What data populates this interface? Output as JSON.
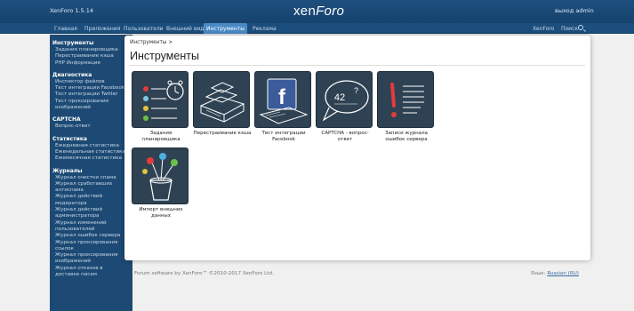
{
  "header": {
    "version": "XenForo 1.5.14",
    "logo": "xenForo",
    "logout": "выход admin"
  },
  "nav": {
    "tabs": [
      "Главная",
      "Приложения",
      "Пользователи",
      "Внешний вид",
      "Инструменты",
      "Реклама"
    ],
    "active_tab": "Инструменты",
    "right": [
      "XenForo",
      "Поиск"
    ]
  },
  "sidebar": {
    "groups": [
      {
        "title": "Инструменты",
        "items": [
          "Задания планировщика",
          "Перестраивание кэша",
          "PHP Информация"
        ]
      },
      {
        "title": "Диагностика",
        "items": [
          "Инспектор файлов",
          "Тест интеграции Facebook",
          "Тест интеграции Twitter",
          "Тест проксирования",
          "изображений"
        ]
      },
      {
        "title": "CAPTCHA",
        "items": [
          "Вопрос-ответ"
        ]
      },
      {
        "title": "Статистика",
        "items": [
          "Ежедневная статистика",
          "Еженедельная статистика",
          "Ежемесячная статистика"
        ]
      },
      {
        "title": "Журналы",
        "items": [
          "Журнал очистки спама",
          "Журнал сработавших",
          "антиспама",
          "Журнал действий",
          "модератора",
          "Журнал действий",
          "администратора",
          "Журнал изменений",
          "пользователей",
          "Журнал ошибок сервера",
          "Журнал проксирования",
          "ссылок",
          "Журнал проксирования",
          "изображений",
          "Журнал отказов в",
          "доставке писем"
        ]
      }
    ]
  },
  "main": {
    "breadcrumb": "Инструменты >",
    "title": "Инструменты",
    "tiles": [
      {
        "label": "Задания планировщика",
        "icon": "cron-icon"
      },
      {
        "label": "Перестраивание кэша",
        "icon": "cache-icon"
      },
      {
        "label": "Тест интеграции Facebook",
        "icon": "facebook-icon"
      },
      {
        "label": "CAPTCHA - вопрос-ответ",
        "icon": "captcha-icon"
      },
      {
        "label": "Записи журнала ошибок сервера",
        "icon": "error-log-icon"
      },
      {
        "label": "Импорт внешних данных",
        "icon": "import-icon"
      }
    ]
  },
  "footer": {
    "left": "Forum software by XenForo™ ©2010-2017 XenForo Ltd.",
    "lang_label": "Язык:",
    "lang_value": "Russian (RU)"
  }
}
